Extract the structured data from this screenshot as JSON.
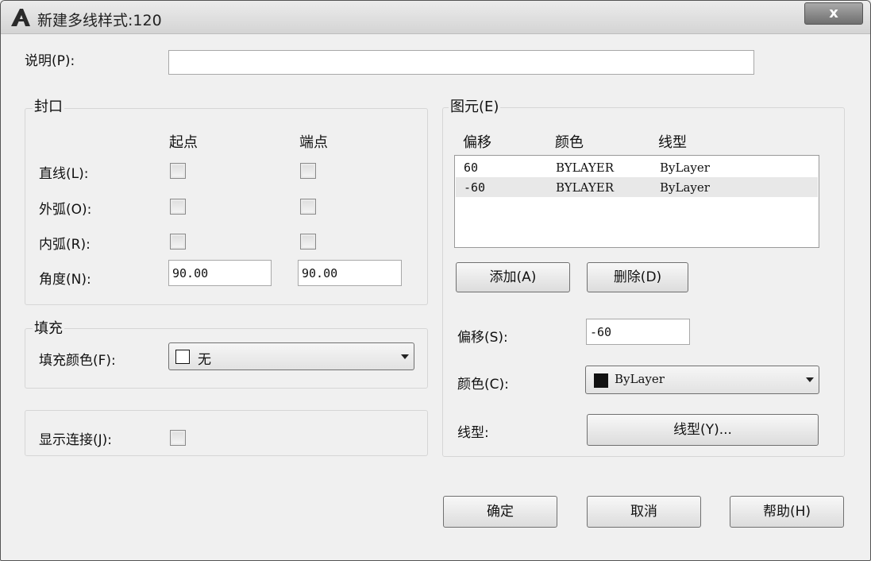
{
  "window": {
    "title": "新建多线样式:120",
    "close_label": "x"
  },
  "description": {
    "label": "说明(P):",
    "value": ""
  },
  "caps": {
    "title": "封口",
    "col_start": "起点",
    "col_end": "端点",
    "line_label": "直线(L):",
    "outer_arc_label": "外弧(O):",
    "inner_arc_label": "内弧(R):",
    "angle_label": "角度(N):",
    "angle_start": "90.00",
    "angle_end": "90.00"
  },
  "fill": {
    "title": "填充",
    "color_label": "填充颜色(F):",
    "color_value": "无"
  },
  "joints": {
    "label": "显示连接(J):"
  },
  "elements": {
    "title": "图元(E)",
    "headers": [
      "偏移",
      "颜色",
      "线型"
    ],
    "rows": [
      {
        "offset": "60",
        "color": "BYLAYER",
        "linetype": "ByLayer"
      },
      {
        "offset": "-60",
        "color": "BYLAYER",
        "linetype": "ByLayer"
      }
    ],
    "add_label": "添加(A)",
    "delete_label": "删除(D)",
    "offset_label": "偏移(S):",
    "offset_value": "-60",
    "color_label": "颜色(C):",
    "color_value": "ByLayer",
    "linetype_label": "线型:",
    "linetype_button": "线型(Y)..."
  },
  "footer": {
    "ok_label": "确定",
    "cancel_label": "取消",
    "help_label": "帮助(H)"
  },
  "colors": {
    "selected_row": "#e8e8e8",
    "titlebar": "#dcdcdc",
    "close_button": "#8a8a8a"
  }
}
